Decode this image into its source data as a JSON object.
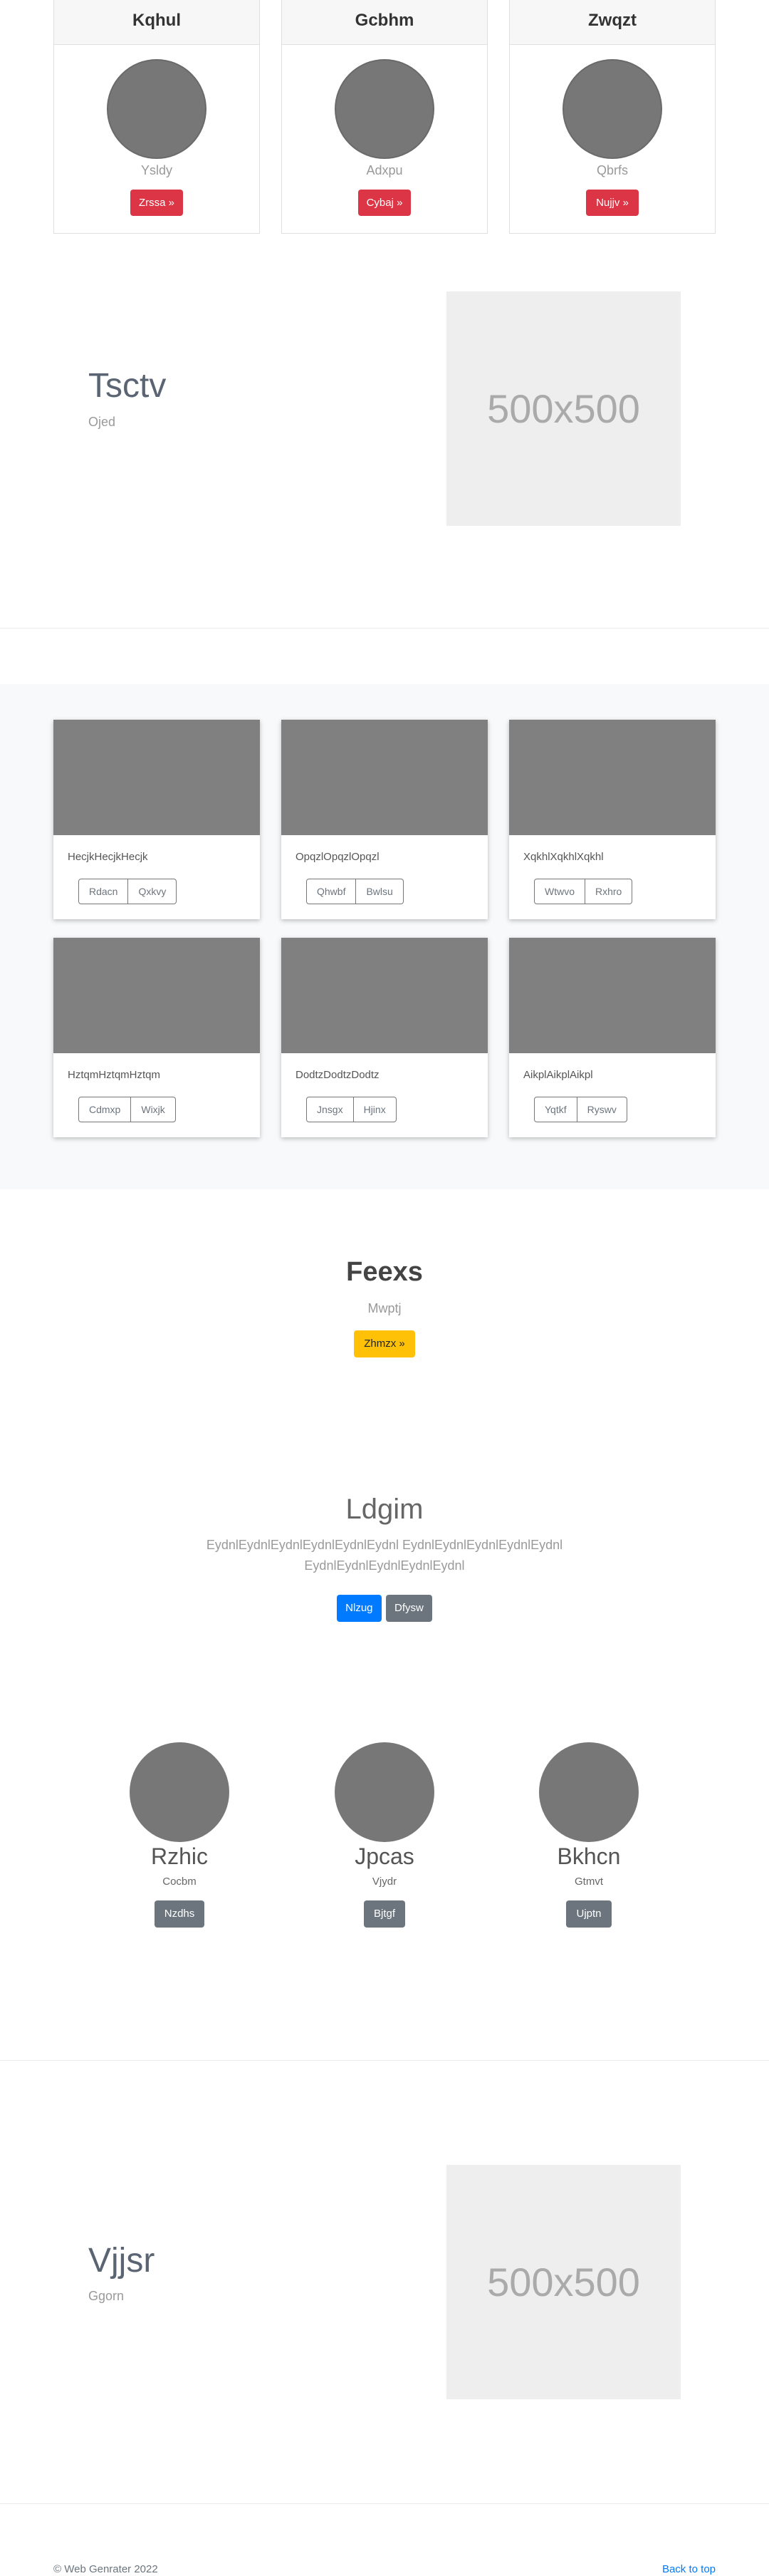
{
  "pricing_cards": [
    {
      "title": "Kqhul",
      "subtitle": "Ysldy",
      "button": "Zrssa »"
    },
    {
      "title": "Gcbhm",
      "subtitle": "Adxpu",
      "button": "Cybaj »"
    },
    {
      "title": "Zwqzt",
      "subtitle": "Qbrfs",
      "button": "Nujjv »"
    }
  ],
  "feature1": {
    "title": "Tsctv",
    "subtitle": "Ojed",
    "placeholder": "500x500"
  },
  "album": [
    {
      "text": "HecjkHecjkHecjk",
      "btn1": "Rdacn",
      "btn2": "Qxkvy"
    },
    {
      "text": "OpqzlOpqzlOpqzl",
      "btn1": "Qhwbf",
      "btn2": "Bwlsu"
    },
    {
      "text": "XqkhlXqkhlXqkhl",
      "btn1": "Wtwvo",
      "btn2": "Rxhro"
    },
    {
      "text": "HztqmHztqmHztqm",
      "btn1": "Cdmxp",
      "btn2": "Wixjk"
    },
    {
      "text": "DodtzDodtzDodtz",
      "btn1": "Jnsgx",
      "btn2": "Hjinx"
    },
    {
      "text": "AikplAikplAikpl",
      "btn1": "Yqtkf",
      "btn2": "Ryswv"
    }
  ],
  "cta": {
    "title": "Feexs",
    "subtitle": "Mwptj",
    "button": "Zhmzx »"
  },
  "hero": {
    "title": "Ldgim",
    "line1": "EydnlEydnlEydnlEydnlEydnlEydnl EydnlEydnlEydnlEydnlEydnl",
    "line2": "EydnlEydnlEydnlEydnlEydnl",
    "primary": "Nlzug",
    "secondary": "Dfysw"
  },
  "team": [
    {
      "name": "Rzhic",
      "role": "Cocbm",
      "button": "Nzdhs"
    },
    {
      "name": "Jpcas",
      "role": "Vjydr",
      "button": "Bjtgf"
    },
    {
      "name": "Bkhcn",
      "role": "Gtmvt",
      "button": "Ujptn"
    }
  ],
  "feature2": {
    "title": "Vjjsr",
    "subtitle": "Ggorn",
    "placeholder": "500x500"
  },
  "footer": {
    "copyright": "© Web Genrater 2022",
    "back_to_top": "Back to top"
  }
}
